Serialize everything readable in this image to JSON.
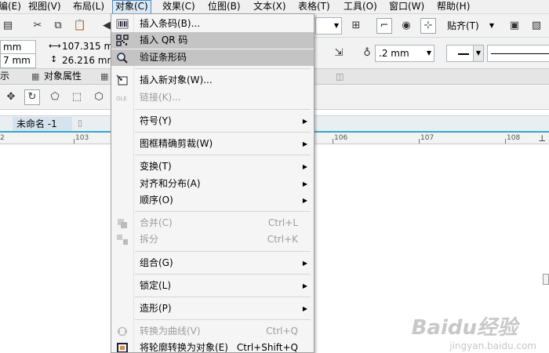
{
  "menubar": {
    "items": [
      {
        "label": "编(E)"
      },
      {
        "label": "视图(V)"
      },
      {
        "label": "布局(L)"
      },
      {
        "label": "对象(C)"
      },
      {
        "label": "效果(C)"
      },
      {
        "label": "位图(B)"
      },
      {
        "label": "文本(X)"
      },
      {
        "label": "表格(T)"
      },
      {
        "label": "工具(O)"
      },
      {
        "label": "窗口(W)"
      },
      {
        "label": "帮助(H)"
      }
    ]
  },
  "toolbar": {
    "snap_label": "贴齐(T)",
    "outline_width": ".2 mm"
  },
  "property_bar": {
    "x_value": "mm",
    "y_value": "7 mm",
    "width_value": "107.315 mm",
    "height_value": "26.216 mm"
  },
  "docker_tabs": [
    {
      "label": "示"
    },
    {
      "label": "对象属性"
    }
  ],
  "document_tab": {
    "label": "未命名 -1"
  },
  "ruler": {
    "ticks": [
      {
        "label": "2"
      },
      {
        "label": "103"
      },
      {
        "label": "106"
      },
      {
        "label": "107"
      },
      {
        "label": "108"
      }
    ]
  },
  "object_menu": {
    "items": [
      {
        "label": "插入条码(B)...",
        "icon": "barcode-icon",
        "state": "normal"
      },
      {
        "label": "插入 QR 码",
        "icon": "qr-code-icon",
        "state": "highlight"
      },
      {
        "label": "验证条形码",
        "icon": "magnify-icon",
        "state": "highlight"
      },
      {
        "label": "插入新对象(W)...",
        "icon": "insert-object-icon",
        "state": "normal"
      },
      {
        "label": "链接(K)...",
        "icon": "ole-icon",
        "state": "disabled"
      },
      {
        "label": "符号(Y)",
        "submenu": true
      },
      {
        "label": "图框精确剪裁(W)",
        "submenu": true
      },
      {
        "label": "变换(T)",
        "submenu": true
      },
      {
        "label": "对齐和分布(A)",
        "submenu": true
      },
      {
        "label": "顺序(O)",
        "submenu": true
      },
      {
        "label": "合并(C)",
        "shortcut": "Ctrl+L",
        "icon": "combine-icon",
        "state": "disabled"
      },
      {
        "label": "拆分",
        "shortcut": "Ctrl+K",
        "icon": "break-apart-icon",
        "state": "disabled"
      },
      {
        "label": "组合(G)",
        "submenu": true
      },
      {
        "label": "锁定(L)",
        "submenu": true
      },
      {
        "label": "造形(P)",
        "submenu": true
      },
      {
        "label": "转换为曲线(V)",
        "shortcut": "Ctrl+Q",
        "icon": "convert-curves-icon",
        "state": "disabled"
      },
      {
        "label": "将轮廓转换为对象(E)",
        "shortcut": "Ctrl+Shift+Q",
        "icon": "outline-to-object-icon",
        "state": "normal"
      }
    ]
  },
  "watermark": {
    "brand": "Baidu经验",
    "url": "jingyan.baidu.com"
  }
}
